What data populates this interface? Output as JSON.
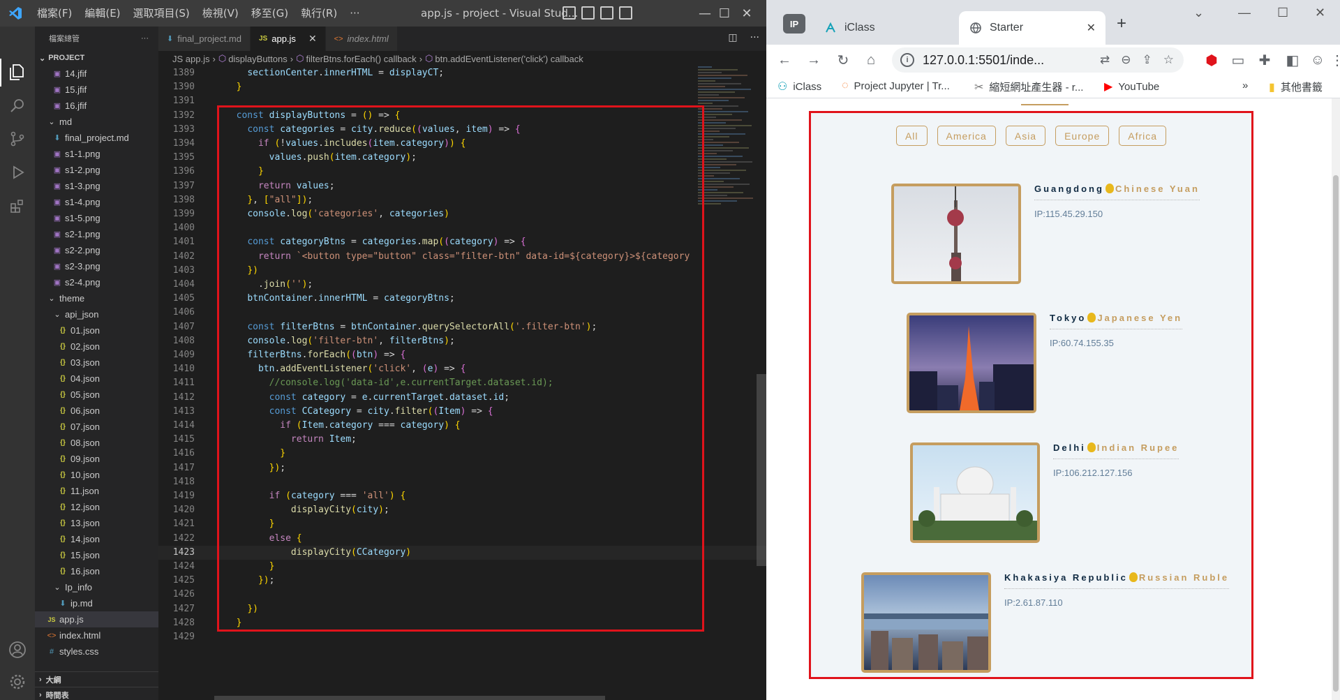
{
  "vscode": {
    "menu": [
      "檔案(F)",
      "編輯(E)",
      "選取項目(S)",
      "檢視(V)",
      "移至(G)",
      "執行(R)",
      "···"
    ],
    "title": "app.js - project - Visual Stud...",
    "sidebar": {
      "header": "檔案總管",
      "more": "···",
      "section": "PROJECT",
      "tree": [
        {
          "label": "14.jfif",
          "type": "img",
          "indent": 2
        },
        {
          "label": "15.jfif",
          "type": "img",
          "indent": 2
        },
        {
          "label": "16.jfif",
          "type": "img",
          "indent": 2
        },
        {
          "label": "md",
          "type": "folder",
          "indent": 1
        },
        {
          "label": "final_project.md",
          "type": "md",
          "indent": 2
        },
        {
          "label": "s1-1.png",
          "type": "img",
          "indent": 2
        },
        {
          "label": "s1-2.png",
          "type": "img",
          "indent": 2
        },
        {
          "label": "s1-3.png",
          "type": "img",
          "indent": 2
        },
        {
          "label": "s1-4.png",
          "type": "img",
          "indent": 2
        },
        {
          "label": "s1-5.png",
          "type": "img",
          "indent": 2
        },
        {
          "label": "s2-1.png",
          "type": "img",
          "indent": 2
        },
        {
          "label": "s2-2.png",
          "type": "img",
          "indent": 2
        },
        {
          "label": "s2-3.png",
          "type": "img",
          "indent": 2
        },
        {
          "label": "s2-4.png",
          "type": "img",
          "indent": 2
        },
        {
          "label": "theme",
          "type": "folder",
          "indent": 1
        },
        {
          "label": "api_json",
          "type": "folder",
          "indent": 2
        },
        {
          "label": "01.json",
          "type": "json",
          "indent": 3
        },
        {
          "label": "02.json",
          "type": "json",
          "indent": 3
        },
        {
          "label": "03.json",
          "type": "json",
          "indent": 3
        },
        {
          "label": "04.json",
          "type": "json",
          "indent": 3
        },
        {
          "label": "05.json",
          "type": "json",
          "indent": 3
        },
        {
          "label": "06.json",
          "type": "json",
          "indent": 3
        },
        {
          "label": "07.json",
          "type": "json",
          "indent": 3
        },
        {
          "label": "08.json",
          "type": "json",
          "indent": 3
        },
        {
          "label": "09.json",
          "type": "json",
          "indent": 3
        },
        {
          "label": "10.json",
          "type": "json",
          "indent": 3
        },
        {
          "label": "11.json",
          "type": "json",
          "indent": 3
        },
        {
          "label": "12.json",
          "type": "json",
          "indent": 3
        },
        {
          "label": "13.json",
          "type": "json",
          "indent": 3
        },
        {
          "label": "14.json",
          "type": "json",
          "indent": 3
        },
        {
          "label": "15.json",
          "type": "json",
          "indent": 3
        },
        {
          "label": "16.json",
          "type": "json",
          "indent": 3
        },
        {
          "label": "Ip_info",
          "type": "folder",
          "indent": 2
        },
        {
          "label": "ip.md",
          "type": "md",
          "indent": 3
        },
        {
          "label": "app.js",
          "type": "js",
          "indent": 1,
          "selected": true
        },
        {
          "label": "index.html",
          "type": "html",
          "indent": 1
        },
        {
          "label": "styles.css",
          "type": "css",
          "indent": 1
        }
      ],
      "outline": "大綱",
      "timeline": "時間表"
    },
    "tabs": [
      {
        "label": "final_project.md",
        "icon": "md"
      },
      {
        "label": "app.js",
        "icon": "JS",
        "active": true
      },
      {
        "label": "index.html",
        "icon": "<>",
        "italic": true
      }
    ],
    "breadcrumb": [
      "JS app.js",
      "displayButtons",
      "filterBtns.forEach() callback",
      "btn.addEventListener('click') callback"
    ],
    "code": [
      {
        "n": "1389",
        "t": "    sectionCenter.innerHTML = displayCT;"
      },
      {
        "n": "1390",
        "t": "  }"
      },
      {
        "n": "1391",
        "t": ""
      },
      {
        "n": "1392",
        "t": "  const displayButtons = () => {"
      },
      {
        "n": "1393",
        "t": "    const categories = city.reduce((values, item) => {"
      },
      {
        "n": "1394",
        "t": "      if (!values.includes(item.category)) {"
      },
      {
        "n": "1395",
        "t": "        values.push(item.category);"
      },
      {
        "n": "1396",
        "t": "      }"
      },
      {
        "n": "1397",
        "t": "      return values;"
      },
      {
        "n": "1398",
        "t": "    }, [\"all\"]);"
      },
      {
        "n": "1399",
        "t": "    console.log('categories', categories)"
      },
      {
        "n": "1400",
        "t": ""
      },
      {
        "n": "1401",
        "t": "    const categoryBtns = categories.map((category) => {"
      },
      {
        "n": "1402",
        "t": "      return `<button type=\"button\" class=\"filter-btn\" data-id=${category}>${category"
      },
      {
        "n": "1403",
        "t": "    })"
      },
      {
        "n": "1404",
        "t": "      .join('');"
      },
      {
        "n": "1405",
        "t": "    btnContainer.innerHTML = categoryBtns;"
      },
      {
        "n": "1406",
        "t": ""
      },
      {
        "n": "1407",
        "t": "    const filterBtns = btnContainer.querySelectorAll('.filter-btn');"
      },
      {
        "n": "1408",
        "t": "    console.log('filter-btn', filterBtns);"
      },
      {
        "n": "1409",
        "t": "    filterBtns.forEach((btn) => {"
      },
      {
        "n": "1410",
        "t": "      btn.addEventListener('click', (e) => {"
      },
      {
        "n": "1411",
        "t": "        //console.log('data-id',e.currentTarget.dataset.id);"
      },
      {
        "n": "1412",
        "t": "        const category = e.currentTarget.dataset.id;"
      },
      {
        "n": "1413",
        "t": "        const CCategory = city.filter((Item) => {"
      },
      {
        "n": "1414",
        "t": "          if (Item.category === category) {"
      },
      {
        "n": "1415",
        "t": "            return Item;"
      },
      {
        "n": "1416",
        "t": "          }"
      },
      {
        "n": "1417",
        "t": "        });"
      },
      {
        "n": "1418",
        "t": ""
      },
      {
        "n": "1419",
        "t": "        if (category === 'all') {"
      },
      {
        "n": "1420",
        "t": "            displayCity(city);"
      },
      {
        "n": "1421",
        "t": "        }"
      },
      {
        "n": "1422",
        "t": "        else {"
      },
      {
        "n": "1423",
        "t": "            displayCity(CCategory)"
      },
      {
        "n": "1424",
        "t": "        }"
      },
      {
        "n": "1425",
        "t": "      });"
      },
      {
        "n": "1426",
        "t": ""
      },
      {
        "n": "1427",
        "t": "    })"
      },
      {
        "n": "1428",
        "t": "  }"
      },
      {
        "n": "1429",
        "t": ""
      }
    ],
    "current_line": "1423"
  },
  "chrome": {
    "tabs": [
      {
        "label": "IP",
        "kind": "group"
      },
      {
        "label": "iClass"
      },
      {
        "label": "Starter",
        "active": true
      }
    ],
    "url": "127.0.0.1:5501/inde...",
    "bookmarks": [
      "iClass",
      "Project Jupyter | Tr...",
      "縮短網址產生器 - r...",
      "YouTube",
      "其他書籤"
    ],
    "bookmarks_overflow": "»",
    "page": {
      "filters": [
        "All",
        "America",
        "Asia",
        "Europe",
        "Africa"
      ],
      "cities": [
        {
          "name": "Guangdong",
          "currency": "Chinese Yuan",
          "ip": "IP:115.45.29.150"
        },
        {
          "name": "Tokyo",
          "currency": "Japanese Yen",
          "ip": "IP:60.74.155.35"
        },
        {
          "name": "Delhi",
          "currency": "Indian Rupee",
          "ip": "IP:106.212.127.156"
        },
        {
          "name": "Khakasiya Republic",
          "currency": "Russian Ruble",
          "ip": "IP:2.61.87.110"
        }
      ]
    }
  },
  "colors": {
    "highlight_box": "#e0131b",
    "accent": "#c59d5f",
    "vscode_blue": "#3ea6ff"
  }
}
